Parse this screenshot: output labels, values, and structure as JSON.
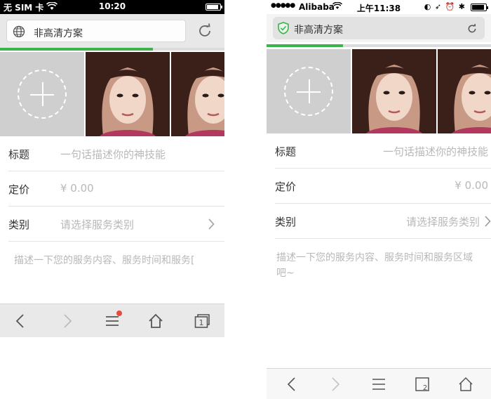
{
  "screen_a": {
    "status": {
      "carrier": "无 SIM 卡",
      "time": "10:20"
    },
    "address": {
      "title": "非高清方案"
    },
    "progress": 0.68,
    "form": {
      "title_label": "标题",
      "title_placeholder": "一句话描述你的神技能",
      "price_label": "定价",
      "price_placeholder": "¥ 0.00",
      "category_label": "类别",
      "category_placeholder": "请选择服务类别",
      "description_placeholder": "描述一下您的服务内容、服务时间和服务["
    },
    "toolbar": {
      "tabs_count": "1",
      "menu_badge": true
    }
  },
  "screen_b": {
    "status": {
      "carrier": "Alibaba",
      "time": "上午11:38"
    },
    "address": {
      "title": "非高清方案"
    },
    "progress": 0.34,
    "form": {
      "title_label": "标题",
      "title_placeholder": "一句话描述你的神技能",
      "price_label": "定价",
      "price_placeholder": "¥ 0.00",
      "category_label": "类别",
      "category_placeholder": "请选择服务类别",
      "description_placeholder": "描述一下您的服务内容、服务时间和服务区域吧~"
    },
    "toolbar": {
      "tabs_count": "2"
    }
  },
  "colors": {
    "progress": "#3cb44b",
    "shield": "#3cb44b",
    "badge": "#e84b3a",
    "placeholder": "#b8b8b8"
  },
  "icons": [
    "globe-icon",
    "reload-icon",
    "shield-icon",
    "plus-icon",
    "back-icon",
    "forward-icon",
    "menu-icon",
    "home-icon",
    "tabs-icon",
    "chevron-right-icon"
  ]
}
